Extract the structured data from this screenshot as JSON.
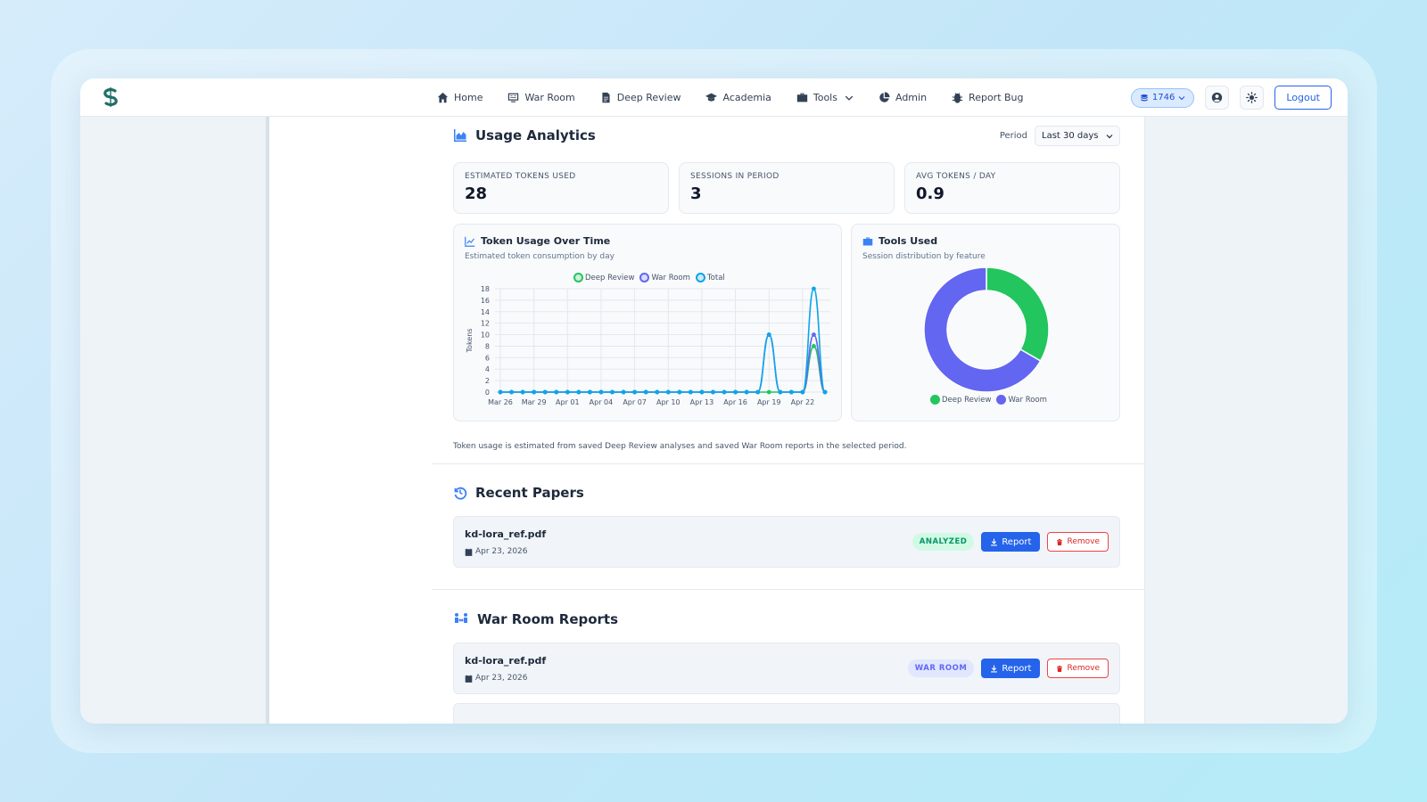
{
  "nav": {
    "items": [
      {
        "label": "Home",
        "icon": "home-icon"
      },
      {
        "label": "War Room",
        "icon": "war-room-icon"
      },
      {
        "label": "Deep Review",
        "icon": "document-icon"
      },
      {
        "label": "Academia",
        "icon": "graduation-cap-icon"
      },
      {
        "label": "Tools",
        "icon": "toolbox-icon"
      },
      {
        "label": "Admin",
        "icon": "pie-chart-icon"
      },
      {
        "label": "Report Bug",
        "icon": "bug-icon"
      }
    ],
    "credits": "1746",
    "logout_label": "Logout"
  },
  "analytics": {
    "title": "Usage Analytics",
    "period_label": "Period",
    "period_value": "Last 30 days",
    "stats": [
      {
        "label": "ESTIMATED TOKENS USED",
        "value": "28"
      },
      {
        "label": "SESSIONS IN PERIOD",
        "value": "3"
      },
      {
        "label": "AVG TOKENS / DAY",
        "value": "0.9"
      }
    ],
    "token_chart": {
      "title": "Token Usage Over Time",
      "subtitle": "Estimated token consumption by day"
    },
    "tools_chart": {
      "title": "Tools Used",
      "subtitle": "Session distribution by feature"
    },
    "footnote": "Token usage is estimated from saved Deep Review analyses and saved War Room reports in the selected period."
  },
  "chart_data": [
    {
      "type": "line",
      "title": "Token Usage Over Time",
      "ylabel": "Tokens",
      "ylim": [
        0,
        18
      ],
      "yticks": [
        0,
        2,
        4,
        6,
        8,
        10,
        12,
        14,
        16,
        18
      ],
      "x": [
        "Mar 26",
        "Mar 27",
        "Mar 28",
        "Mar 29",
        "Mar 30",
        "Mar 31",
        "Apr 01",
        "Apr 02",
        "Apr 03",
        "Apr 04",
        "Apr 05",
        "Apr 06",
        "Apr 07",
        "Apr 08",
        "Apr 09",
        "Apr 10",
        "Apr 11",
        "Apr 12",
        "Apr 13",
        "Apr 14",
        "Apr 15",
        "Apr 16",
        "Apr 17",
        "Apr 18",
        "Apr 19",
        "Apr 20",
        "Apr 21",
        "Apr 22",
        "Apr 23",
        "Apr 24"
      ],
      "xtick_labels": [
        "Mar 26",
        "Mar 29",
        "Apr 01",
        "Apr 04",
        "Apr 07",
        "Apr 10",
        "Apr 13",
        "Apr 16",
        "Apr 19",
        "Apr 22"
      ],
      "series": [
        {
          "name": "Deep Review",
          "color": "#22c55e",
          "values": [
            0,
            0,
            0,
            0,
            0,
            0,
            0,
            0,
            0,
            0,
            0,
            0,
            0,
            0,
            0,
            0,
            0,
            0,
            0,
            0,
            0,
            0,
            0,
            0,
            0,
            0,
            0,
            0,
            8,
            0
          ]
        },
        {
          "name": "War Room",
          "color": "#6366f1",
          "values": [
            0,
            0,
            0,
            0,
            0,
            0,
            0,
            0,
            0,
            0,
            0,
            0,
            0,
            0,
            0,
            0,
            0,
            0,
            0,
            0,
            0,
            0,
            0,
            0,
            10,
            0,
            0,
            0,
            10,
            0
          ]
        },
        {
          "name": "Total",
          "color": "#0ea5e9",
          "values": [
            0,
            0,
            0,
            0,
            0,
            0,
            0,
            0,
            0,
            0,
            0,
            0,
            0,
            0,
            0,
            0,
            0,
            0,
            0,
            0,
            0,
            0,
            0,
            0,
            10,
            0,
            0,
            0,
            18,
            0
          ]
        }
      ],
      "grid": true,
      "legend": "top"
    },
    {
      "type": "pie",
      "title": "Tools Used",
      "categories": [
        "Deep Review",
        "War Room"
      ],
      "values": [
        1,
        2
      ],
      "colors": [
        "#22c55e",
        "#6366f1"
      ],
      "legend": "bottom"
    }
  ],
  "recent_papers": {
    "title": "Recent Papers",
    "items": [
      {
        "name": "kd-lora_ref.pdf",
        "date": "Apr 23, 2026",
        "badge": "ANALYZED",
        "report_label": "Report",
        "remove_label": "Remove"
      }
    ]
  },
  "war_room_reports": {
    "title": "War Room Reports",
    "items": [
      {
        "name": "kd-lora_ref.pdf",
        "date": "Apr 23, 2026",
        "badge": "WAR ROOM",
        "report_label": "Report",
        "remove_label": "Remove"
      }
    ]
  }
}
